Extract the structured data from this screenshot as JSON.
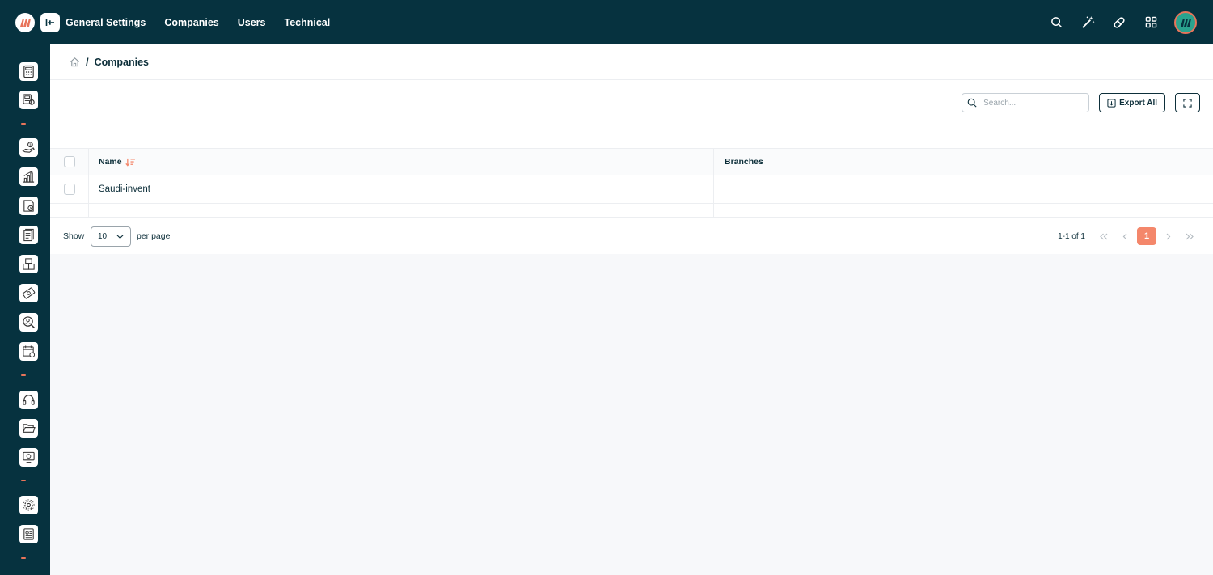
{
  "app": {
    "logo_icon": "brand-logo-icon",
    "collapse_icon": "collapse-sidebar-icon",
    "accent_color": "#f4876b",
    "nav_color": "#06323f"
  },
  "topnav": {
    "items": [
      {
        "label": "General Settings"
      },
      {
        "label": "Companies"
      },
      {
        "label": "Users"
      },
      {
        "label": "Technical"
      }
    ]
  },
  "top_actions": {
    "icons": [
      "search-icon",
      "magic-wand-icon",
      "pill-icon",
      "apps-grid-icon",
      "user-avatar"
    ]
  },
  "sidebar": {
    "icons": [
      "calculator-doc-icon",
      "pos-terminal-icon",
      "hand-money-icon",
      "bar-chart-icon",
      "clock-doc-icon",
      "receipt-doc-icon",
      "boxes-icon",
      "banknote-icon",
      "search-person-icon",
      "calendar-clock-icon",
      "headset-icon",
      "folder-open-icon",
      "monitor-icon",
      "gear-cog-icon",
      "id-badge-icon"
    ]
  },
  "breadcrumb": {
    "home_icon": "home-icon",
    "separator": "/",
    "current": "Companies"
  },
  "toolbar": {
    "search_placeholder": "Search...",
    "export_label": "Export All"
  },
  "table": {
    "columns": {
      "name": "Name",
      "branches": "Branches"
    },
    "rows": [
      {
        "name": "Saudi-invent",
        "branches": ""
      }
    ]
  },
  "pagination": {
    "show_label": "Show",
    "per_page_value": "10",
    "per_page_label": "per page",
    "range": "1-1 of 1",
    "current_page": "1"
  }
}
